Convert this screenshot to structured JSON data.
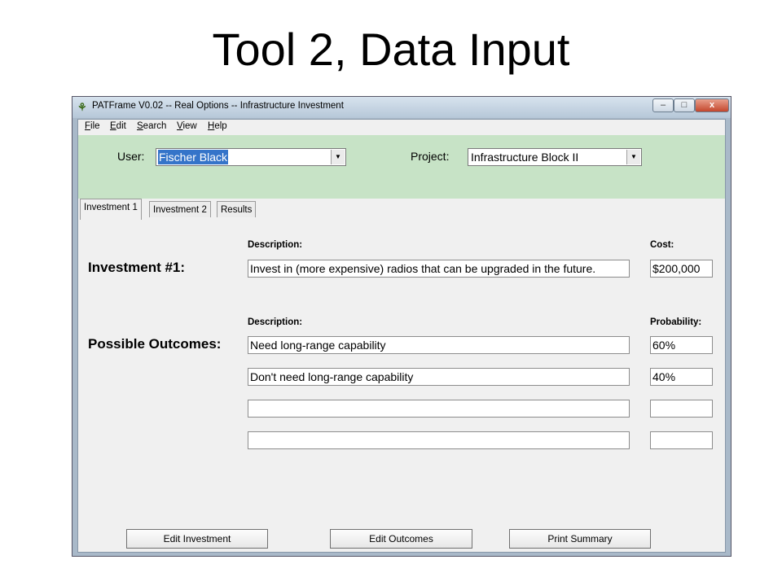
{
  "slide": {
    "title": "Tool 2, Data Input"
  },
  "window": {
    "title": "PATFrame V0.02  -- Real Options -- Infrastructure Investment",
    "icon": "app-logo-icon",
    "controls": {
      "minimize": "–",
      "maximize": "□",
      "close": "x"
    }
  },
  "menu": {
    "items": [
      "File",
      "Edit",
      "Search",
      "View",
      "Help"
    ]
  },
  "top_panel": {
    "user_label": "User:",
    "user_value": "Fischer Black",
    "project_label": "Project:",
    "project_value": "Infrastructure Block II",
    "background": "#c7e3c6"
  },
  "tabs": [
    "Investment 1",
    "Investment 2",
    "Results"
  ],
  "investment": {
    "label": "Investment #1:",
    "description_header": "Description:",
    "cost_header": "Cost:",
    "description": "Invest in (more expensive) radios that can be upgraded in the future.",
    "cost": "$200,000"
  },
  "outcomes": {
    "label": "Possible Outcomes:",
    "description_header": "Description:",
    "probability_header": "Probability:",
    "rows": [
      {
        "description": "Need long-range capability",
        "probability": "60%"
      },
      {
        "description": "Don't need long-range capability",
        "probability": "40%"
      },
      {
        "description": "",
        "probability": ""
      },
      {
        "description": "",
        "probability": ""
      }
    ]
  },
  "buttons": {
    "edit_investment": "Edit Investment",
    "edit_outcomes": "Edit Outcomes",
    "print_summary": "Print Summary"
  }
}
